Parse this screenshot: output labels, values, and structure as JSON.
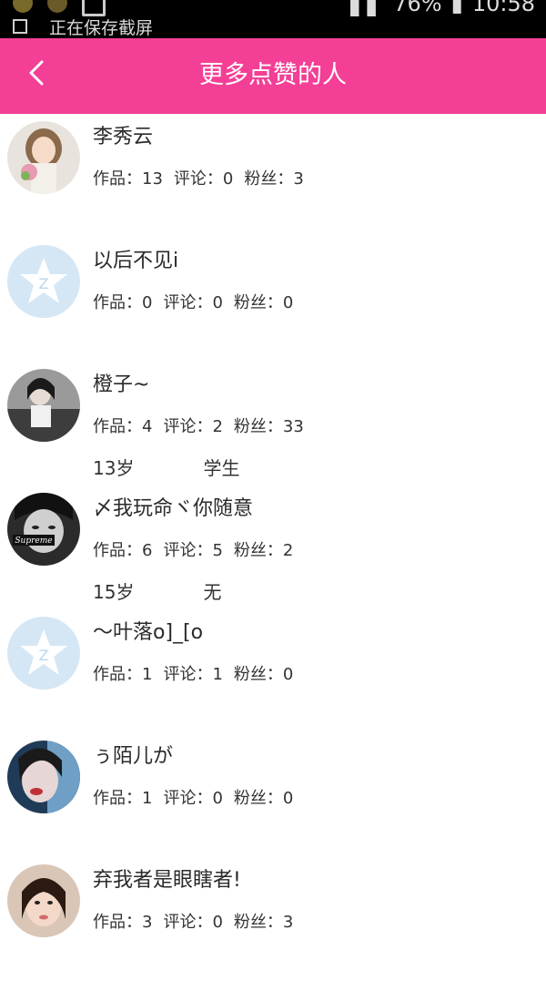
{
  "status_bar": {
    "notice": "正在保存截屏",
    "battery": "76%",
    "time": "10:58"
  },
  "header": {
    "title": "更多点赞的人",
    "back_icon": "chevron-left-icon",
    "background": "#f43f96"
  },
  "users": [
    {
      "name": "李秀云",
      "works": "作品：13",
      "comments": "评论：0",
      "fans": "粉丝：3",
      "avatar": "cartoon-girl-avatar"
    },
    {
      "name": "以后不见i",
      "works": "作品：0",
      "comments": "评论：0",
      "fans": "粉丝：0",
      "avatar": "default-qq-avatar"
    },
    {
      "name": "橙子~",
      "works": "作品：4",
      "comments": "评论：2",
      "fans": "粉丝：33",
      "age": "13岁",
      "occupation": "学生",
      "avatar": "photo-avatar"
    },
    {
      "name": "〆我玩命ヾ你随意",
      "works": "作品：6",
      "comments": "评论：5",
      "fans": "粉丝：2",
      "age": "15岁",
      "occupation": "无",
      "avatar": "bw-photo-avatar",
      "avatar_text": "Supreme"
    },
    {
      "name": "～叶落o]_[o",
      "works": "作品：1",
      "comments": "评论：1",
      "fans": "粉丝：0",
      "avatar": "default-qq-avatar"
    },
    {
      "name": "ぅ陌儿が",
      "works": "作品：1",
      "comments": "评论：0",
      "fans": "粉丝：0",
      "avatar": "photo-avatar"
    },
    {
      "name": "弃我者是眼瞎者!",
      "works": "作品：3",
      "comments": "评论：0",
      "fans": "粉丝：3",
      "avatar": "photo-avatar"
    }
  ]
}
